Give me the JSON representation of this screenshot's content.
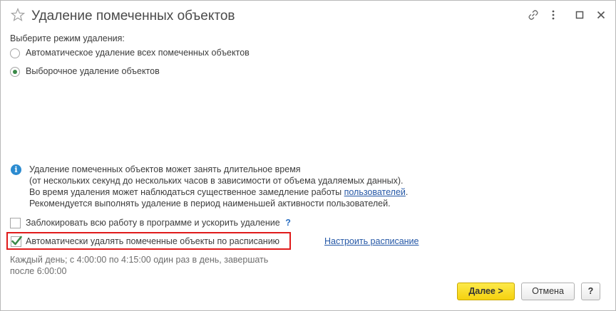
{
  "window": {
    "title": "Удаление помеченных объектов"
  },
  "mode": {
    "label": "Выберите режим удаления:",
    "options": [
      {
        "label": "Автоматическое удаление всех помеченных объектов",
        "selected": false
      },
      {
        "label": "Выборочное удаление объектов",
        "selected": true
      }
    ]
  },
  "info": {
    "line1": "Удаление помеченных объектов может занять длительное время",
    "line2": "(от нескольких секунд до нескольких часов в зависимости от объема удаляемых данных).",
    "line3_prefix": "Во время удаления может наблюдаться существенное замедление работы ",
    "line3_link": "пользователей",
    "line3_suffix": ".",
    "line4": "Рекомендуется выполнять удаление в период наименьшей активности пользователей."
  },
  "block_option": {
    "label": "Заблокировать всю работу в программе и ускорить удаление",
    "checked": false,
    "help": "?"
  },
  "schedule_option": {
    "label": "Автоматически удалять помеченные объекты по расписанию",
    "checked": true,
    "link": "Настроить расписание",
    "hint_line1": "Каждый день; с 4:00:00 по 4:15:00 один раз в день, завершать",
    "hint_line2": "после 6:00:00"
  },
  "buttons": {
    "next": "Далее >",
    "cancel": "Отмена",
    "help": "?"
  },
  "colors": {
    "accent_green": "#3a8a48",
    "primary_yellow": "#f5d10f",
    "link_blue": "#2457a6",
    "highlight_red": "#e01b1b"
  }
}
